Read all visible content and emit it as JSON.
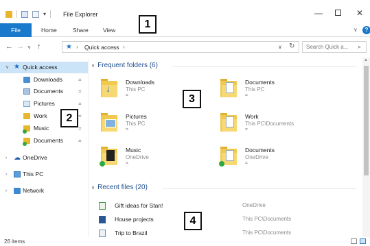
{
  "window": {
    "title": "File Explorer",
    "qat_dropdown": "▾",
    "minimize": "—",
    "close": "✕"
  },
  "ribbon": {
    "tabs": [
      "File",
      "Home",
      "Share",
      "View"
    ],
    "collapse_caret": "∨",
    "help": "?"
  },
  "address": {
    "back": "←",
    "forward": "→",
    "recent": "∨",
    "up": "↑",
    "sep": "›",
    "path": "Quick access",
    "dropdown": "∨",
    "refresh": "↻",
    "search_placeholder": "Search Quick a...",
    "search_icon": "⌕"
  },
  "nav": {
    "expand": "›",
    "collapse": "∨",
    "pin": "⌗",
    "quick_access": "Quick access",
    "items": [
      {
        "label": "Downloads",
        "icon": "download-folder-icon"
      },
      {
        "label": "Documents",
        "icon": "documents-icon"
      },
      {
        "label": "Pictures",
        "icon": "pictures-icon"
      },
      {
        "label": "Work",
        "icon": "folder-icon"
      },
      {
        "label": "Music",
        "icon": "music-folder-icon"
      },
      {
        "label": "Documents",
        "icon": "documents-icon"
      }
    ],
    "onedrive": "OneDrive",
    "thispc": "This PC",
    "network": "Network"
  },
  "content": {
    "frequent_header": "Frequent folders (6)",
    "folders": [
      {
        "name": "Downloads",
        "location": "This PC"
      },
      {
        "name": "Documents",
        "location": "This PC"
      },
      {
        "name": "Pictures",
        "location": "This PC"
      },
      {
        "name": "Work",
        "location": "This PC\\Documents"
      },
      {
        "name": "Music",
        "location": "OneDrive"
      },
      {
        "name": "Documents",
        "location": "OneDrive"
      }
    ],
    "pin_glyph": "⌗",
    "recent_header": "Recent files (20)",
    "recent": [
      {
        "name": "Gift ideas for Stan!",
        "location": "OneDrive"
      },
      {
        "name": "House projects",
        "location": "This PC\\Documents"
      },
      {
        "name": "Trip to Brazil",
        "location": "This PC\\Documents"
      }
    ]
  },
  "scroll": {
    "up": "▲"
  },
  "status": {
    "items_count": "26 items"
  },
  "markers": [
    "1",
    "2",
    "3",
    "4"
  ],
  "colors": {
    "accent": "#1979ca",
    "selection": "#cce4f7",
    "folder": "#f0c94e",
    "header": "#1e4e8c"
  }
}
